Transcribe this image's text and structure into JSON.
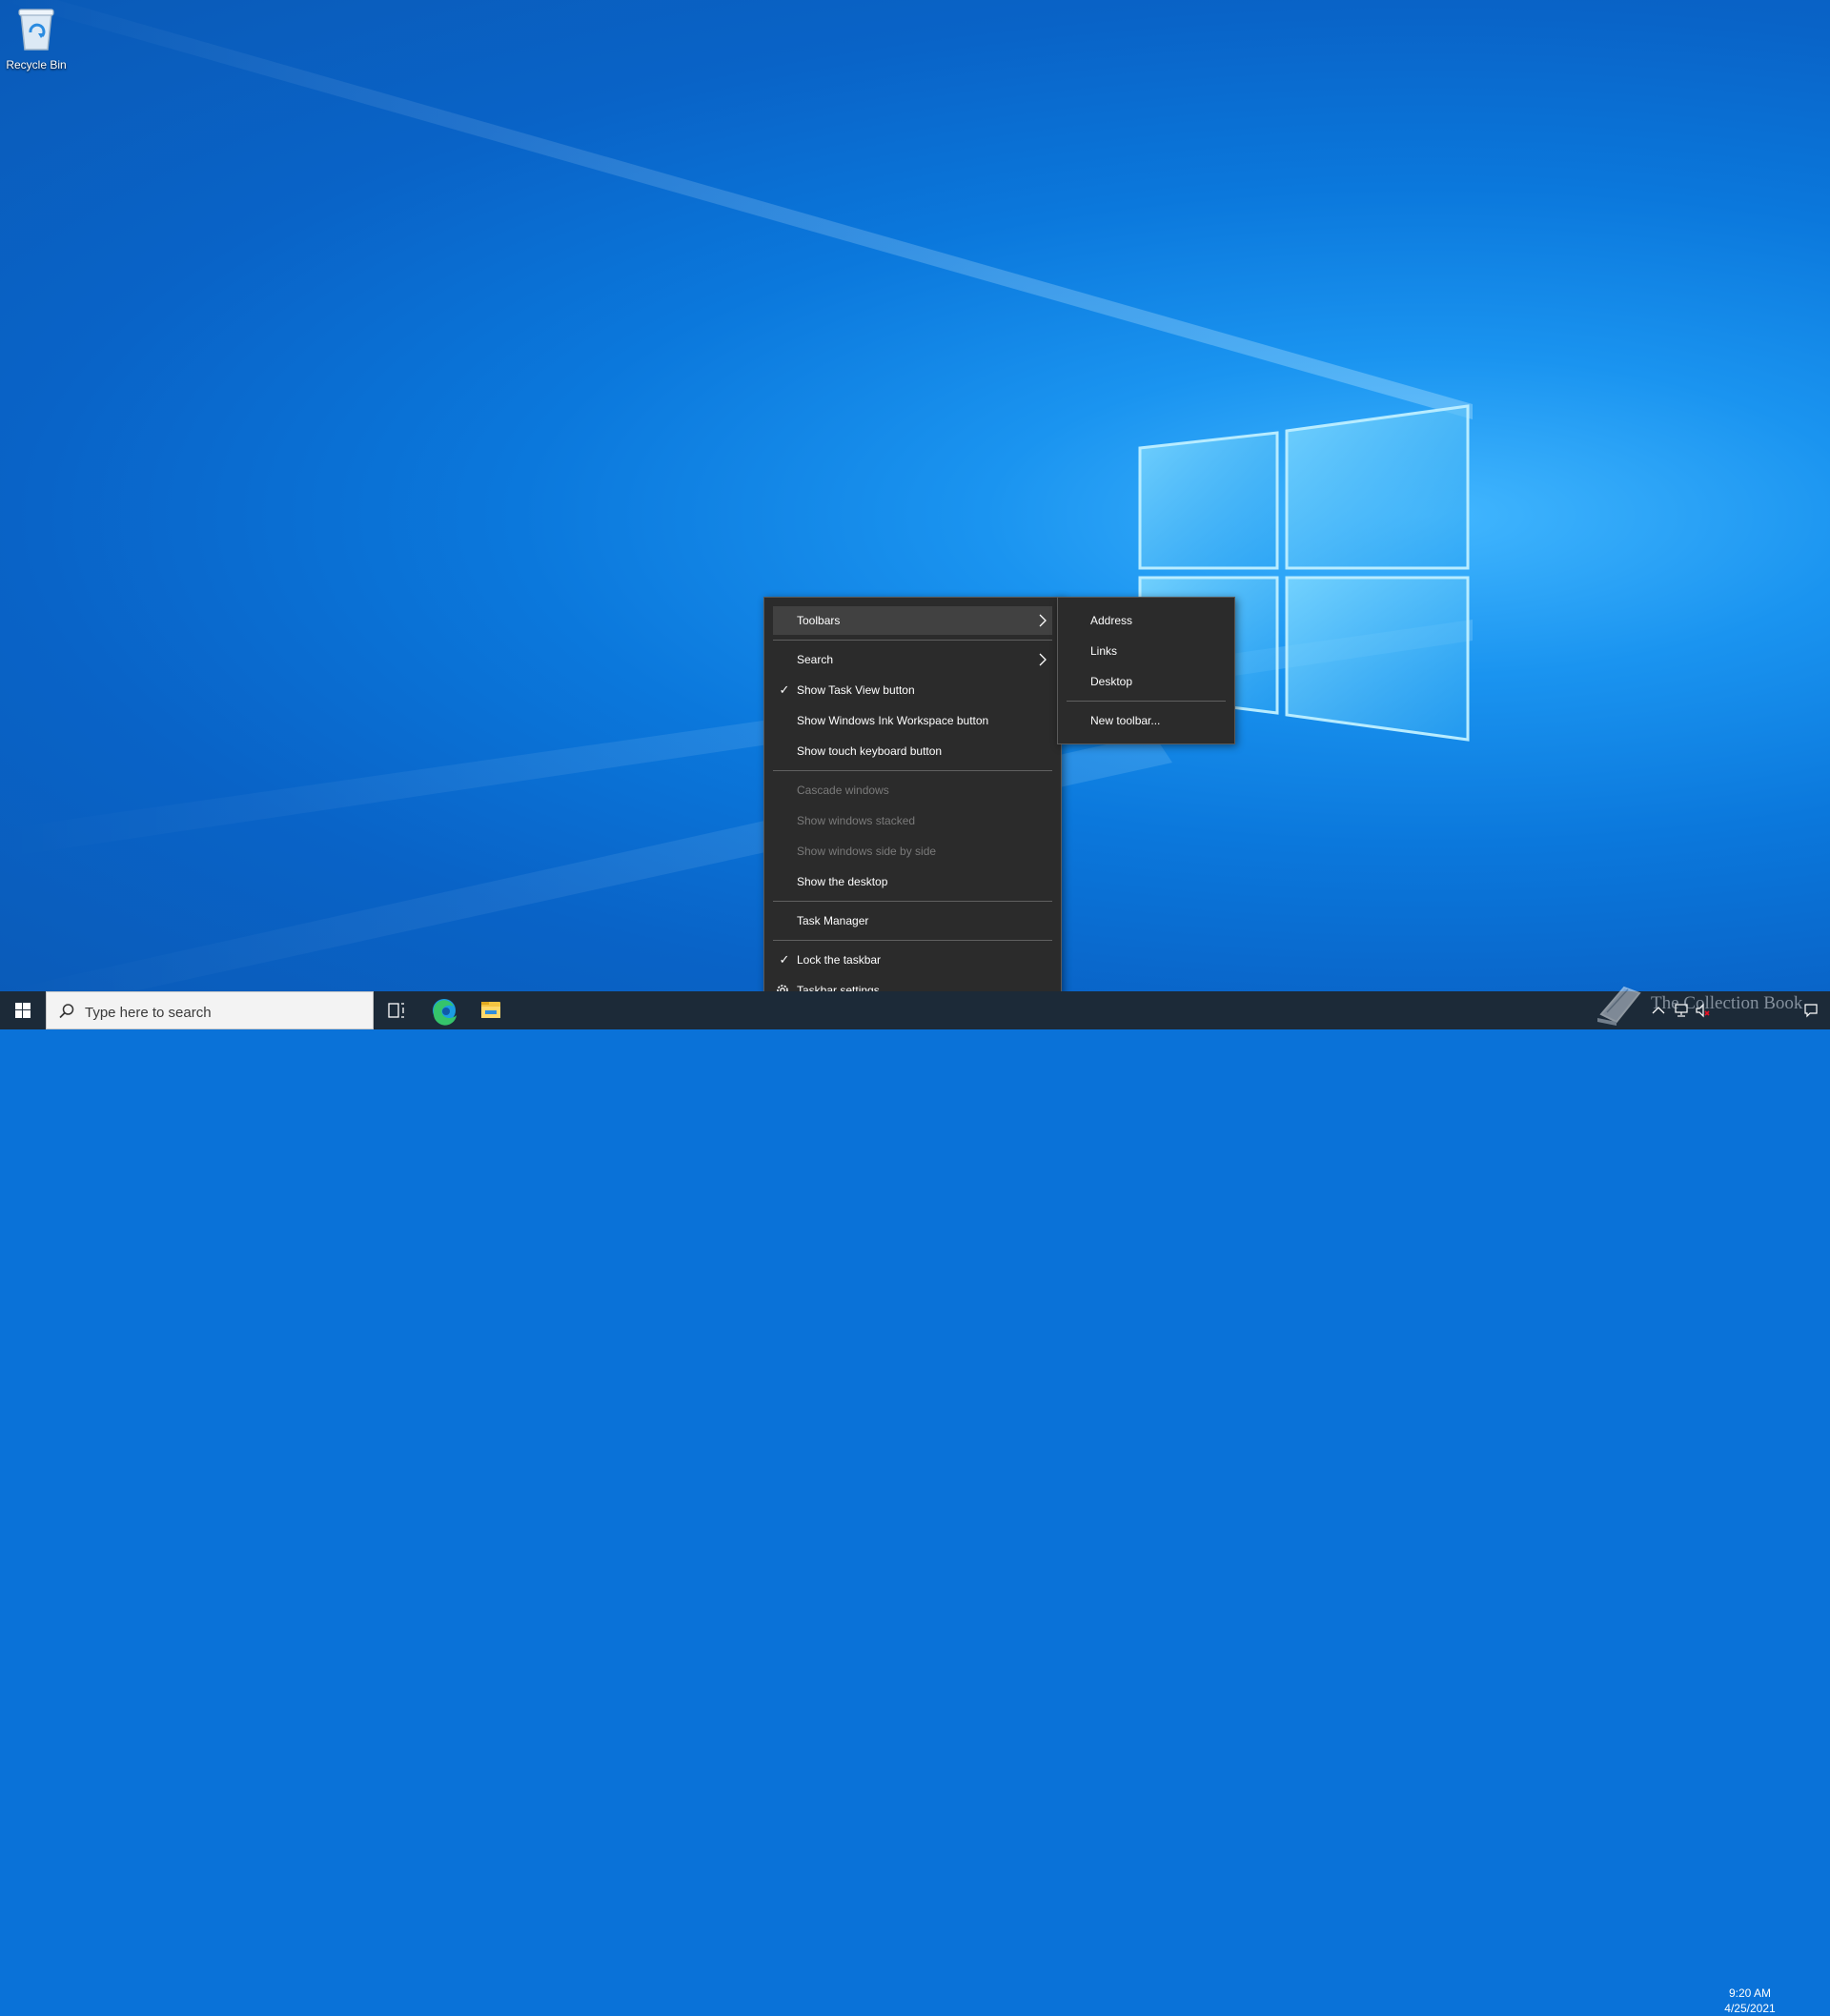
{
  "desktop": {
    "icons": [
      {
        "label": "Recycle Bin",
        "icon": "recycle-bin-icon"
      }
    ]
  },
  "context_menu": {
    "toolbars": "Toolbars",
    "search": "Search",
    "show_task_view": "Show Task View button",
    "show_ink_workspace": "Show Windows Ink Workspace button",
    "show_touch_keyboard": "Show touch keyboard button",
    "cascade_windows": "Cascade windows",
    "show_windows_stacked": "Show windows stacked",
    "show_windows_side_by_side": "Show windows side by side",
    "show_desktop": "Show the desktop",
    "task_manager": "Task Manager",
    "lock_taskbar": "Lock the taskbar",
    "taskbar_settings": "Taskbar settings",
    "checked": [
      "Show Task View button",
      "Lock the taskbar"
    ],
    "disabled": [
      "Cascade windows",
      "Show windows stacked",
      "Show windows side by side"
    ]
  },
  "toolbars_submenu": {
    "address": "Address",
    "links": "Links",
    "desktop": "Desktop",
    "new_toolbar": "New toolbar..."
  },
  "taskbar": {
    "search_placeholder": "Type here to search",
    "pinned": [
      "task-view-icon",
      "edge-icon",
      "file-explorer-icon"
    ],
    "clock_time": "9:20 AM",
    "clock_date": "4/25/2021"
  },
  "watermark": {
    "text": "The Collection Book"
  },
  "colors": {
    "menu_bg": "#2b2b2b",
    "menu_hover": "#414141",
    "taskbar": "#1c2a38",
    "accent": "#0a78d7"
  }
}
